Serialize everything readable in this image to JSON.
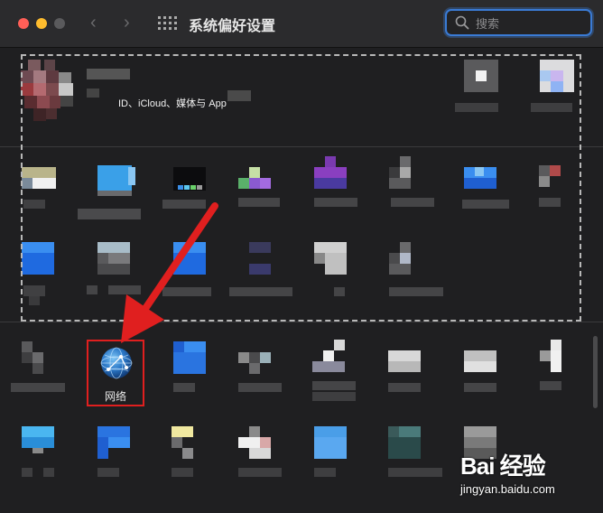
{
  "window": {
    "title": "系统偏好设置",
    "back_glyph": "‹",
    "forward_glyph": "›"
  },
  "search": {
    "placeholder": "搜索",
    "value": ""
  },
  "apple_id": {
    "subtitle": "ID、iCloud、媒体与 App"
  },
  "highlighted_pane": {
    "label": "网络",
    "icon": "network-globe-icon",
    "highlight_color": "#e01f1f"
  },
  "colors": {
    "accent": "#3a7bd5",
    "arrow": "#e01f1f"
  },
  "watermark": {
    "brand": "Bai 经验",
    "url": "jingyan.baidu.com"
  }
}
